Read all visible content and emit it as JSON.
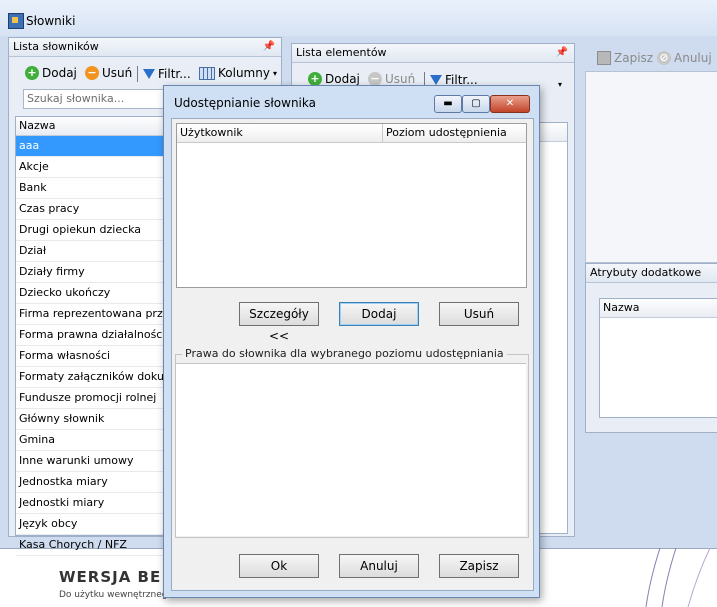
{
  "app": {
    "title": "Słowniki"
  },
  "dict_list_panel": {
    "title": "Lista słowników",
    "toolbar": {
      "add": "Dodaj",
      "remove": "Usuń",
      "filter": "Filtr...",
      "columns": "Kolumny"
    },
    "search_placeholder": "Szukaj słownika...",
    "column_header": "Nazwa",
    "items": [
      "aaa",
      "Akcje",
      "Bank",
      "Czas pracy",
      "Drugi opiekun dziecka",
      "Dział",
      "Działy firmy",
      "Dziecko ukończy",
      "Firma reprezentowana przez",
      "Forma prawna działalności",
      "Forma własności",
      "Formaty załączników dokume...",
      "Fundusze promocji rolnej",
      "Główny słownik",
      "Gmina",
      "Inne warunki umowy",
      "Jednostka miary",
      "Jednostki miary",
      "Język obcy",
      "Kasa Chorych / NFZ"
    ],
    "selected_index": 0
  },
  "elements_panel": {
    "title": "Lista elementów",
    "toolbar": {
      "add": "Dodaj",
      "remove": "Usuń",
      "filter": "Filtr..."
    }
  },
  "details_panel": {
    "toolbar": {
      "save": "Zapisz",
      "cancel": "Anuluj"
    },
    "extra_attributes": {
      "title": "Atrybuty dodatkowe",
      "column_header": "Nazwa"
    }
  },
  "dialog": {
    "title": "Udostępnianie słownika",
    "users_table": {
      "columns": [
        "Użytkownik",
        "Poziom udostępnienia"
      ]
    },
    "buttons_mid": {
      "details": "Szczegóły <<",
      "add": "Dodaj",
      "remove": "Usuń"
    },
    "rights_group": "Prawa do słownika dla wybranego poziomu udostępniania",
    "buttons_bottom": {
      "ok": "Ok",
      "cancel": "Anuluj",
      "save": "Zapisz"
    }
  },
  "footer": {
    "brand": "WERSJA BE",
    "note": "Do użytku wewnętrznego"
  }
}
